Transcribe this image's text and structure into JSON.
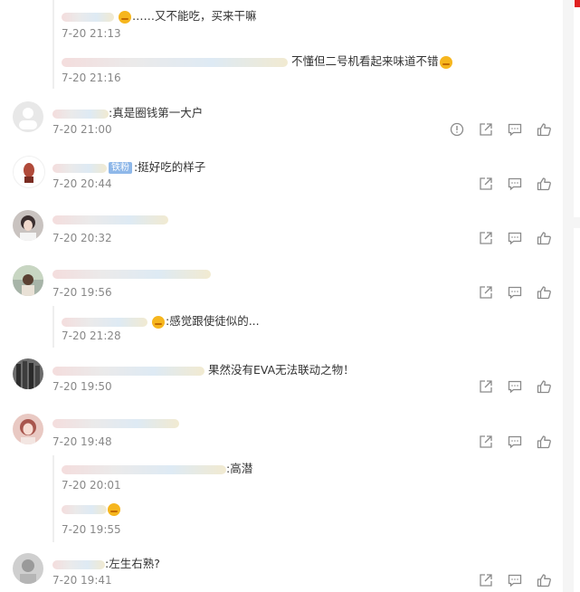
{
  "threads": [
    {
      "type": "replies-only",
      "replies": [
        {
          "text": "……又不能吃，买来干嘛",
          "time": "7-20 21:13"
        },
        {
          "text": "不懂但二号机看起来味道不错",
          "time": "7-20 21:16"
        }
      ]
    },
    {
      "text": "真是圈钱第一大户",
      "time": "7-20 21:00",
      "has_report": true
    },
    {
      "text": "挺好吃的样子",
      "badge": "铁粉",
      "time": "7-20 20:44"
    },
    {
      "text": "",
      "time": "7-20 20:32"
    },
    {
      "text": "",
      "time": "7-20 19:56",
      "replies": [
        {
          "text": "感觉跟使徒似的...",
          "time": "7-20 21:28"
        }
      ]
    },
    {
      "text": "果然没有EVA无法联动之物！",
      "time": "7-20 19:50"
    },
    {
      "text": "",
      "time": "7-20 19:48",
      "replies": [
        {
          "text": "高潜",
          "time": "7-20 20:01"
        },
        {
          "text": "",
          "time": "7-20 19:55"
        }
      ]
    },
    {
      "text": "左生右熟?",
      "time": "7-20 19:41"
    }
  ],
  "icons": {
    "report": "report-icon",
    "share": "share-icon",
    "comment": "comment-icon",
    "like": "like-icon"
  },
  "colors": {
    "time": "#888888",
    "badge": "#8fb8e9",
    "icon": "#8a8a8a"
  }
}
